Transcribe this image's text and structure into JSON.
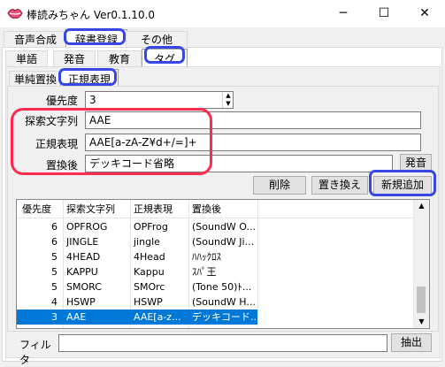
{
  "window": {
    "title": "棒読みちゃん Ver0.1.10.0",
    "minimize": "─",
    "maximize": "☐",
    "close": "✕"
  },
  "main_tabs": [
    "音声合成",
    "辞書登録",
    "その他"
  ],
  "sub_tabs": [
    "単語",
    "発音",
    "教育",
    "タグ"
  ],
  "tag_tabs": [
    "単純置換",
    "正規表現"
  ],
  "form": {
    "priority_label": "優先度",
    "priority_value": "3",
    "search_label": "探索文字列",
    "search_value": "AAE",
    "regex_label": "正規表現",
    "regex_value": "AAE[a-zA-Z¥d+/=]+",
    "replace_label": "置換後",
    "replace_value": "デッキコード省略"
  },
  "buttons": {
    "pronounce": "発音",
    "delete": "削除",
    "replace": "置き換え",
    "add": "新規追加",
    "extract": "抽出"
  },
  "table": {
    "headers": [
      "優先度",
      "探索文字列",
      "正規表現",
      "置換後"
    ],
    "rows": [
      [
        "6",
        "OPFROG",
        "OPFrog",
        "(SoundW O..."
      ],
      [
        "6",
        "JINGLE",
        "jingle",
        "(SoundW Ji..."
      ],
      [
        "5",
        "4HEAD",
        "4Head",
        "ﾊﾊｯｸﾛｽ"
      ],
      [
        "5",
        "KAPPU",
        "Kappu",
        "ｽﾊﾟ王"
      ],
      [
        "5",
        "SMORC",
        "SMOrc",
        "(Tone 50)ﾄ..."
      ],
      [
        "4",
        "HSWP",
        "HSWP",
        "(SoundW H..."
      ],
      [
        "3",
        "AAE",
        "AAE[a-z...",
        "デッキコード..."
      ]
    ]
  },
  "filter": {
    "label": "フィルタ",
    "value": ""
  }
}
